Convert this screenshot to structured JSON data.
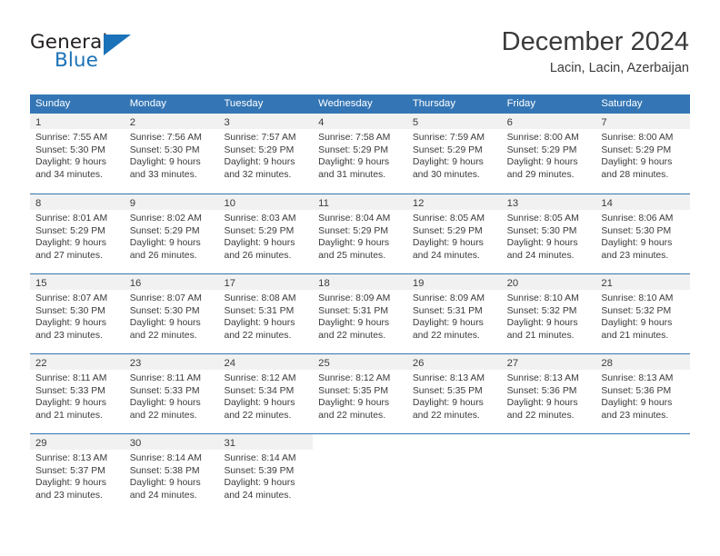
{
  "brand": {
    "word_one": "General",
    "word_two": "Blue",
    "flag_icon": "triangle-flag-icon"
  },
  "header": {
    "title": "December 2024",
    "subtitle": "Lacin, Lacin, Azerbaijan"
  },
  "colors": {
    "header_blue": "#3476b5",
    "brand_blue": "#1b72b8",
    "daynum_band": "#f1f1f1",
    "text": "#3b3b3b"
  },
  "calendar": {
    "weekday_headers": [
      "Sunday",
      "Monday",
      "Tuesday",
      "Wednesday",
      "Thursday",
      "Friday",
      "Saturday"
    ],
    "weeks": [
      [
        {
          "day": "1",
          "sunrise": "Sunrise: 7:55 AM",
          "sunset": "Sunset: 5:30 PM",
          "daylight1": "Daylight: 9 hours",
          "daylight2": "and 34 minutes."
        },
        {
          "day": "2",
          "sunrise": "Sunrise: 7:56 AM",
          "sunset": "Sunset: 5:30 PM",
          "daylight1": "Daylight: 9 hours",
          "daylight2": "and 33 minutes."
        },
        {
          "day": "3",
          "sunrise": "Sunrise: 7:57 AM",
          "sunset": "Sunset: 5:29 PM",
          "daylight1": "Daylight: 9 hours",
          "daylight2": "and 32 minutes."
        },
        {
          "day": "4",
          "sunrise": "Sunrise: 7:58 AM",
          "sunset": "Sunset: 5:29 PM",
          "daylight1": "Daylight: 9 hours",
          "daylight2": "and 31 minutes."
        },
        {
          "day": "5",
          "sunrise": "Sunrise: 7:59 AM",
          "sunset": "Sunset: 5:29 PM",
          "daylight1": "Daylight: 9 hours",
          "daylight2": "and 30 minutes."
        },
        {
          "day": "6",
          "sunrise": "Sunrise: 8:00 AM",
          "sunset": "Sunset: 5:29 PM",
          "daylight1": "Daylight: 9 hours",
          "daylight2": "and 29 minutes."
        },
        {
          "day": "7",
          "sunrise": "Sunrise: 8:00 AM",
          "sunset": "Sunset: 5:29 PM",
          "daylight1": "Daylight: 9 hours",
          "daylight2": "and 28 minutes."
        }
      ],
      [
        {
          "day": "8",
          "sunrise": "Sunrise: 8:01 AM",
          "sunset": "Sunset: 5:29 PM",
          "daylight1": "Daylight: 9 hours",
          "daylight2": "and 27 minutes."
        },
        {
          "day": "9",
          "sunrise": "Sunrise: 8:02 AM",
          "sunset": "Sunset: 5:29 PM",
          "daylight1": "Daylight: 9 hours",
          "daylight2": "and 26 minutes."
        },
        {
          "day": "10",
          "sunrise": "Sunrise: 8:03 AM",
          "sunset": "Sunset: 5:29 PM",
          "daylight1": "Daylight: 9 hours",
          "daylight2": "and 26 minutes."
        },
        {
          "day": "11",
          "sunrise": "Sunrise: 8:04 AM",
          "sunset": "Sunset: 5:29 PM",
          "daylight1": "Daylight: 9 hours",
          "daylight2": "and 25 minutes."
        },
        {
          "day": "12",
          "sunrise": "Sunrise: 8:05 AM",
          "sunset": "Sunset: 5:29 PM",
          "daylight1": "Daylight: 9 hours",
          "daylight2": "and 24 minutes."
        },
        {
          "day": "13",
          "sunrise": "Sunrise: 8:05 AM",
          "sunset": "Sunset: 5:30 PM",
          "daylight1": "Daylight: 9 hours",
          "daylight2": "and 24 minutes."
        },
        {
          "day": "14",
          "sunrise": "Sunrise: 8:06 AM",
          "sunset": "Sunset: 5:30 PM",
          "daylight1": "Daylight: 9 hours",
          "daylight2": "and 23 minutes."
        }
      ],
      [
        {
          "day": "15",
          "sunrise": "Sunrise: 8:07 AM",
          "sunset": "Sunset: 5:30 PM",
          "daylight1": "Daylight: 9 hours",
          "daylight2": "and 23 minutes."
        },
        {
          "day": "16",
          "sunrise": "Sunrise: 8:07 AM",
          "sunset": "Sunset: 5:30 PM",
          "daylight1": "Daylight: 9 hours",
          "daylight2": "and 22 minutes."
        },
        {
          "day": "17",
          "sunrise": "Sunrise: 8:08 AM",
          "sunset": "Sunset: 5:31 PM",
          "daylight1": "Daylight: 9 hours",
          "daylight2": "and 22 minutes."
        },
        {
          "day": "18",
          "sunrise": "Sunrise: 8:09 AM",
          "sunset": "Sunset: 5:31 PM",
          "daylight1": "Daylight: 9 hours",
          "daylight2": "and 22 minutes."
        },
        {
          "day": "19",
          "sunrise": "Sunrise: 8:09 AM",
          "sunset": "Sunset: 5:31 PM",
          "daylight1": "Daylight: 9 hours",
          "daylight2": "and 22 minutes."
        },
        {
          "day": "20",
          "sunrise": "Sunrise: 8:10 AM",
          "sunset": "Sunset: 5:32 PM",
          "daylight1": "Daylight: 9 hours",
          "daylight2": "and 21 minutes."
        },
        {
          "day": "21",
          "sunrise": "Sunrise: 8:10 AM",
          "sunset": "Sunset: 5:32 PM",
          "daylight1": "Daylight: 9 hours",
          "daylight2": "and 21 minutes."
        }
      ],
      [
        {
          "day": "22",
          "sunrise": "Sunrise: 8:11 AM",
          "sunset": "Sunset: 5:33 PM",
          "daylight1": "Daylight: 9 hours",
          "daylight2": "and 21 minutes."
        },
        {
          "day": "23",
          "sunrise": "Sunrise: 8:11 AM",
          "sunset": "Sunset: 5:33 PM",
          "daylight1": "Daylight: 9 hours",
          "daylight2": "and 22 minutes."
        },
        {
          "day": "24",
          "sunrise": "Sunrise: 8:12 AM",
          "sunset": "Sunset: 5:34 PM",
          "daylight1": "Daylight: 9 hours",
          "daylight2": "and 22 minutes."
        },
        {
          "day": "25",
          "sunrise": "Sunrise: 8:12 AM",
          "sunset": "Sunset: 5:35 PM",
          "daylight1": "Daylight: 9 hours",
          "daylight2": "and 22 minutes."
        },
        {
          "day": "26",
          "sunrise": "Sunrise: 8:13 AM",
          "sunset": "Sunset: 5:35 PM",
          "daylight1": "Daylight: 9 hours",
          "daylight2": "and 22 minutes."
        },
        {
          "day": "27",
          "sunrise": "Sunrise: 8:13 AM",
          "sunset": "Sunset: 5:36 PM",
          "daylight1": "Daylight: 9 hours",
          "daylight2": "and 22 minutes."
        },
        {
          "day": "28",
          "sunrise": "Sunrise: 8:13 AM",
          "sunset": "Sunset: 5:36 PM",
          "daylight1": "Daylight: 9 hours",
          "daylight2": "and 23 minutes."
        }
      ],
      [
        {
          "day": "29",
          "sunrise": "Sunrise: 8:13 AM",
          "sunset": "Sunset: 5:37 PM",
          "daylight1": "Daylight: 9 hours",
          "daylight2": "and 23 minutes."
        },
        {
          "day": "30",
          "sunrise": "Sunrise: 8:14 AM",
          "sunset": "Sunset: 5:38 PM",
          "daylight1": "Daylight: 9 hours",
          "daylight2": "and 24 minutes."
        },
        {
          "day": "31",
          "sunrise": "Sunrise: 8:14 AM",
          "sunset": "Sunset: 5:39 PM",
          "daylight1": "Daylight: 9 hours",
          "daylight2": "and 24 minutes."
        },
        {
          "day": "",
          "sunrise": "",
          "sunset": "",
          "daylight1": "",
          "daylight2": ""
        },
        {
          "day": "",
          "sunrise": "",
          "sunset": "",
          "daylight1": "",
          "daylight2": ""
        },
        {
          "day": "",
          "sunrise": "",
          "sunset": "",
          "daylight1": "",
          "daylight2": ""
        },
        {
          "day": "",
          "sunrise": "",
          "sunset": "",
          "daylight1": "",
          "daylight2": ""
        }
      ]
    ]
  }
}
